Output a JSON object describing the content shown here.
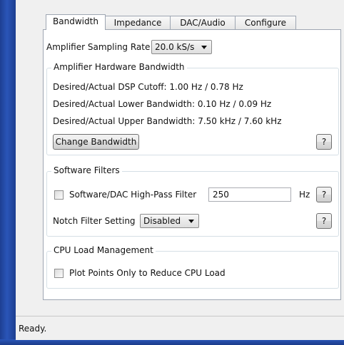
{
  "tabs": [
    {
      "label": "Bandwidth",
      "active": true
    },
    {
      "label": "Impedance",
      "active": false
    },
    {
      "label": "DAC/Audio",
      "active": false
    },
    {
      "label": "Configure",
      "active": false
    }
  ],
  "sampling": {
    "label": "Amplifier Sampling Rate",
    "value": "20.0 kS/s"
  },
  "hardware_bandwidth": {
    "title": "Amplifier Hardware Bandwidth",
    "dsp_cutoff": "Desired/Actual DSP Cutoff: 1.00 Hz / 0.78 Hz",
    "lower_bandwidth": "Desired/Actual Lower Bandwidth: 0.10 Hz / 0.09 Hz",
    "upper_bandwidth": "Desired/Actual Upper Bandwidth: 7.50 kHz / 7.60 kHz",
    "change_button": "Change Bandwidth",
    "help_button": "?"
  },
  "software_filters": {
    "title": "Software Filters",
    "highpass_label": "Software/DAC High-Pass Filter",
    "highpass_checked": false,
    "highpass_value": "250",
    "highpass_unit": "Hz",
    "highpass_help": "?",
    "notch_label": "Notch Filter Setting",
    "notch_value": "Disabled",
    "notch_help": "?"
  },
  "cpu_load": {
    "title": "CPU Load Management",
    "plot_points_label": "Plot Points Only to Reduce CPU Load",
    "plot_points_checked": false
  },
  "status": {
    "text": "Ready."
  },
  "colors": {
    "taskbar_blue": "#2a55b8",
    "window_bg": "#f0f0f0",
    "page_bg": "#ffffff"
  }
}
